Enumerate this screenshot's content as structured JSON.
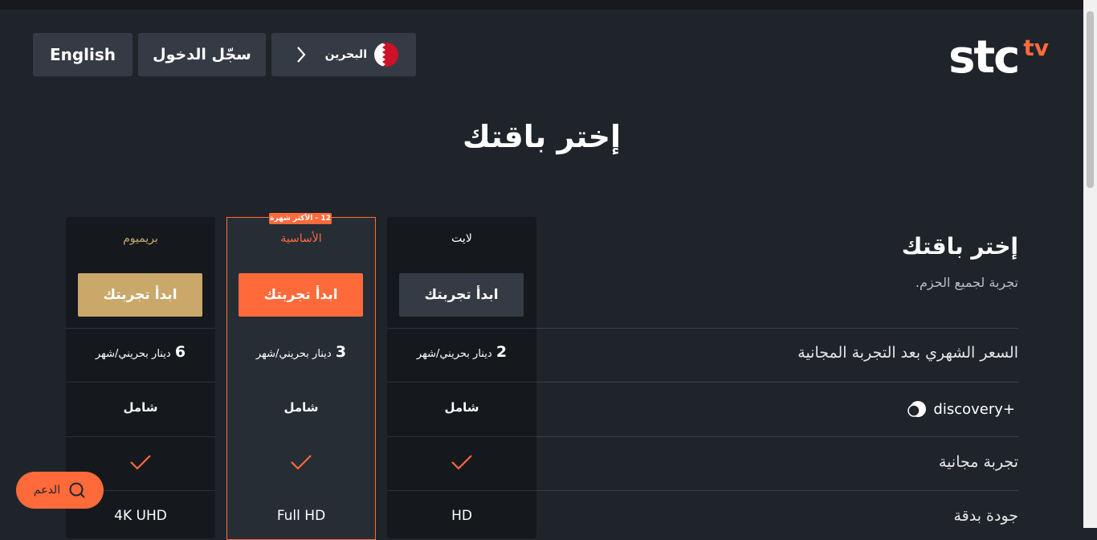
{
  "header": {
    "english_label": "English",
    "login_label": "سجّل الدخول",
    "country_label": "البحرين",
    "logo_main": "stc",
    "logo_sub": "tv"
  },
  "page_title": "إختر باقتك",
  "intro": {
    "title": "إختر باقتك",
    "subtitle": "تجربة لجميع الحزم."
  },
  "plans": [
    {
      "name": "لايت",
      "cta": "ابدأ تجربتك",
      "price_num": "2",
      "price_unit": "دينار بحريني/شهر",
      "discovery": "شامل",
      "quality": "HD",
      "cta_color": "#353b44"
    },
    {
      "name": "الأساسية",
      "cta": "ابدأ تجربتك",
      "price_num": "3",
      "price_unit": "دينار بحريني/شهر",
      "discovery": "شامل",
      "quality": "Full HD",
      "badge": "12 - الأكثر شهرة",
      "cta_color": "#ff6a3a"
    },
    {
      "name": "بريميوم",
      "cta": "ابدأ تجربتك",
      "price_num": "6",
      "price_unit": "دينار بحريني/شهر",
      "discovery": "شامل",
      "quality": "4K UHD",
      "cta_color": "#c9a86a"
    }
  ],
  "rows": {
    "price_label": "السعر الشهري بعد التجربة المجانية",
    "discovery_label": "discovery+",
    "trial_label": "تجربة مجانية",
    "quality_label": "جودة بدقة"
  },
  "support_label": "الدعم",
  "colors": {
    "accent": "#ff6a3a",
    "premium": "#c9a86a",
    "premium_text": "#c9a86a",
    "background": "#1f242b"
  },
  "icons": {
    "flag": "bahrain-flag-icon",
    "chevron": "chevron-right-icon",
    "check": "check-icon",
    "support": "chat-bubble-icon",
    "discovery": "discovery-logo-icon"
  }
}
